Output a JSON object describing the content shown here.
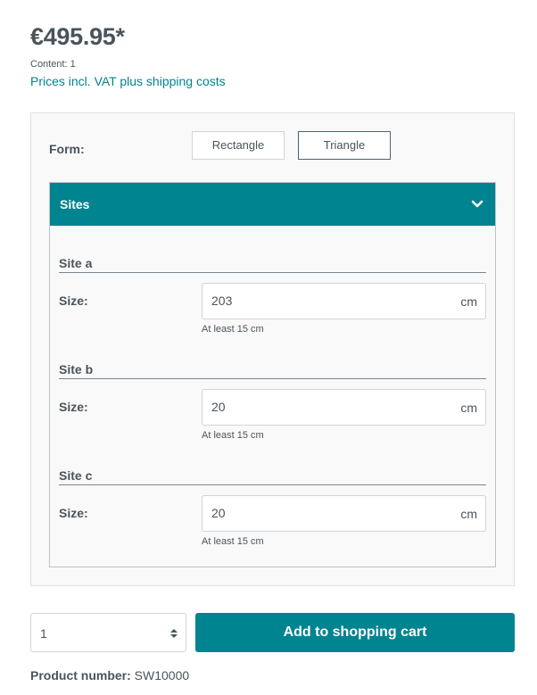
{
  "product": {
    "price": "€495.95*",
    "content": "Content: 1",
    "vat_note": "Prices incl. VAT plus shipping costs",
    "product_number_label": "Product number:",
    "product_number_value": "SW10000"
  },
  "configurator": {
    "form_label": "Form:",
    "form_options": [
      {
        "label": "Rectangle",
        "selected": false
      },
      {
        "label": "Triangle",
        "selected": true
      }
    ],
    "sites_panel": {
      "title": "Sites",
      "expanded": true,
      "toggle_icon": "chevron-down-icon",
      "sites": [
        {
          "title": "Site a",
          "size_label": "Size:",
          "value": "203",
          "unit": "cm",
          "hint": "At least 15 cm"
        },
        {
          "title": "Site b",
          "size_label": "Size:",
          "value": "20",
          "unit": "cm",
          "hint": "At least 15 cm"
        },
        {
          "title": "Site c",
          "size_label": "Size:",
          "value": "20",
          "unit": "cm",
          "hint": "At least 15 cm"
        }
      ]
    }
  },
  "buy": {
    "quantity": "1",
    "add_to_cart_label": "Add to shopping cart"
  },
  "colors": {
    "accent": "#008490",
    "text": "#4a545b"
  }
}
